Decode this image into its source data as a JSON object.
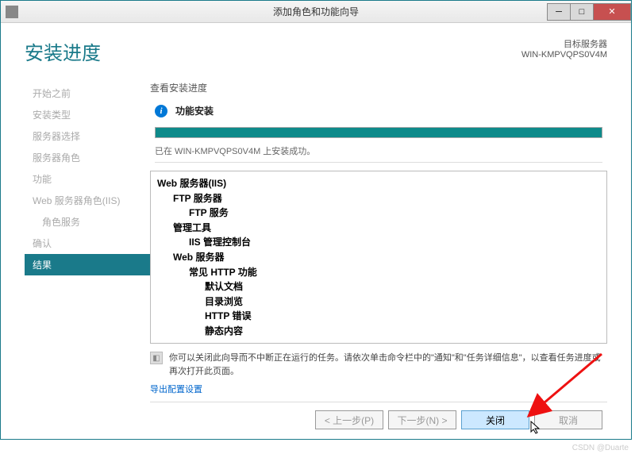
{
  "titlebar": {
    "text": "添加角色和功能向导"
  },
  "page_title": "安装进度",
  "target": {
    "label": "目标服务器",
    "name": "WIN-KMPVQPS0V4M"
  },
  "sidebar": [
    {
      "label": "开始之前",
      "active": false
    },
    {
      "label": "安装类型",
      "active": false
    },
    {
      "label": "服务器选择",
      "active": false
    },
    {
      "label": "服务器角色",
      "active": false
    },
    {
      "label": "功能",
      "active": false
    },
    {
      "label": "Web 服务器角色(IIS)",
      "active": false
    },
    {
      "label": "角色服务",
      "active": false,
      "sub": true
    },
    {
      "label": "确认",
      "active": false
    },
    {
      "label": "结果",
      "active": true
    }
  ],
  "section_label": "查看安装进度",
  "status": {
    "title": "功能安装",
    "message": "已在 WIN-KMPVQPS0V4M 上安装成功。"
  },
  "tree": [
    {
      "level": 0,
      "text": "Web 服务器(IIS)"
    },
    {
      "level": 1,
      "text": "FTP 服务器"
    },
    {
      "level": 2,
      "text": "FTP 服务"
    },
    {
      "level": 1,
      "text": "管理工具"
    },
    {
      "level": 2,
      "text": "IIS 管理控制台"
    },
    {
      "level": 1,
      "text": "Web 服务器"
    },
    {
      "level": 2,
      "text": "常见 HTTP 功能"
    },
    {
      "level": 3,
      "text": "默认文档"
    },
    {
      "level": 3,
      "text": "目录浏览"
    },
    {
      "level": 3,
      "text": "HTTP 错误"
    },
    {
      "level": 3,
      "text": "静态内容"
    }
  ],
  "hint": "你可以关闭此向导而不中断正在运行的任务。请依次单击命令栏中的\"通知\"和\"任务详细信息\"，以查看任务进度或再次打开此页面。",
  "export_link": "导出配置设置",
  "buttons": {
    "prev": "< 上一步(P)",
    "next": "下一步(N) >",
    "close": "关闭",
    "cancel": "取消"
  },
  "watermark": "CSDN @Duarte"
}
